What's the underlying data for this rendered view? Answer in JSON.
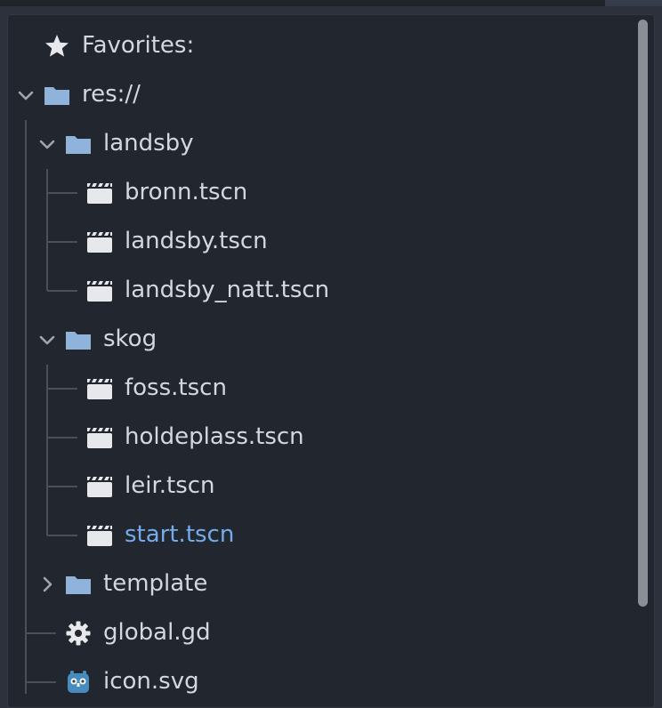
{
  "favorites": {
    "label": "Favorites:",
    "icon": "star-icon"
  },
  "tree": {
    "root": {
      "label": "res://",
      "icon": "folder-icon",
      "expanded": true
    },
    "folders": [
      {
        "label": "landsby",
        "icon": "folder-icon",
        "expanded": true,
        "files": [
          {
            "label": "bronn.tscn",
            "icon": "scene-clapperboard-icon"
          },
          {
            "label": "landsby.tscn",
            "icon": "scene-clapperboard-icon"
          },
          {
            "label": "landsby_natt.tscn",
            "icon": "scene-clapperboard-icon"
          }
        ]
      },
      {
        "label": "skog",
        "icon": "folder-icon",
        "expanded": true,
        "files": [
          {
            "label": "foss.tscn",
            "icon": "scene-clapperboard-icon"
          },
          {
            "label": "holdeplass.tscn",
            "icon": "scene-clapperboard-icon"
          },
          {
            "label": "leir.tscn",
            "icon": "scene-clapperboard-icon"
          },
          {
            "label": "start.tscn",
            "icon": "scene-clapperboard-icon",
            "selected": true
          }
        ]
      },
      {
        "label": "template",
        "icon": "folder-icon",
        "expanded": false
      }
    ],
    "root_files": [
      {
        "label": "global.gd",
        "icon": "gear-icon"
      },
      {
        "label": "icon.svg",
        "icon": "godot-logo-icon"
      }
    ]
  },
  "colors": {
    "panel_bg": "#22262e",
    "text": "#d4d8de",
    "selected_text": "#73abed",
    "folder": "#8fb3db",
    "guide_line": "#4a4f58"
  }
}
